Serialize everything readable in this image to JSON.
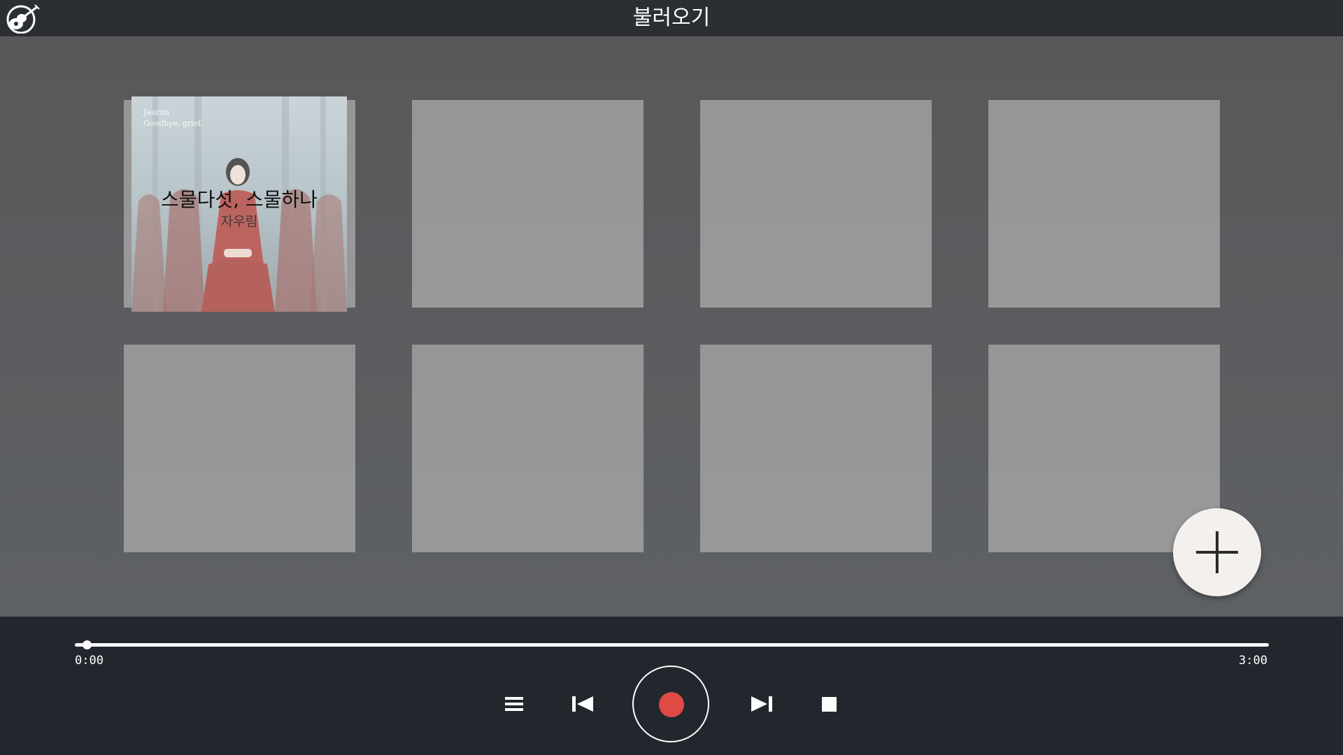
{
  "header": {
    "title": "불러오기",
    "logo_icon": "guitar-logo-icon"
  },
  "grid": {
    "slots": [
      {
        "album_art_text_line1": "Jaurim",
        "album_art_text_line2": "Goodbye, grief.",
        "song_title": "스물다섯, 스물하나",
        "artist": "자우림"
      },
      {},
      {},
      {},
      {},
      {},
      {},
      {}
    ],
    "add_button_icon": "plus-icon"
  },
  "player": {
    "current_time": "0:00",
    "total_time": "3:00",
    "progress": 0.01,
    "controls": {
      "list_icon": "list-icon",
      "previous_icon": "skip-previous-icon",
      "record_icon": "record-icon",
      "next_icon": "skip-next-icon",
      "stop_icon": "stop-icon"
    }
  },
  "colors": {
    "header_bg": "#2b2f34",
    "player_bg": "#22272e",
    "record": "#e04a45",
    "tile": "#999999",
    "fab": "#f3f0ee"
  }
}
